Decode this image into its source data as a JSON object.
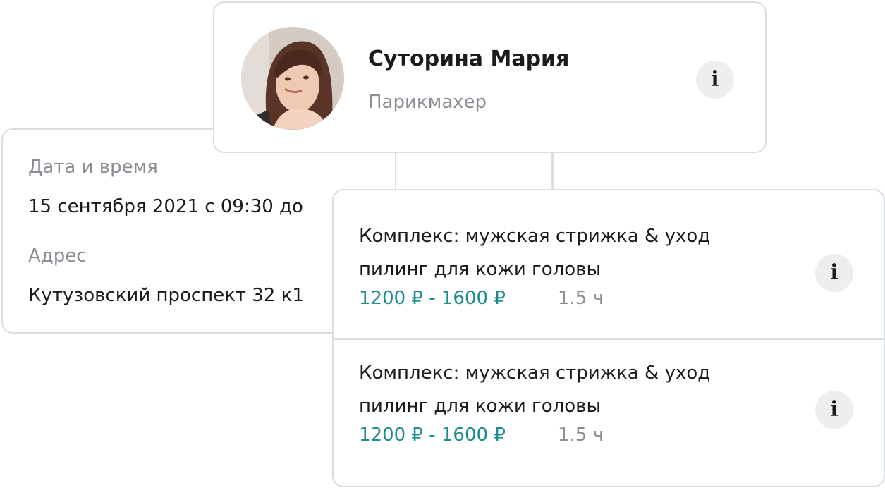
{
  "master": {
    "name": "Суторина Мария",
    "role": "Парикмахер",
    "info_icon": "i"
  },
  "details": {
    "date_label": "Дата и время",
    "date_value": "15 сентября 2021 с 09:30 до",
    "address_label": "Адрес",
    "address_value": "Кутузовский проспект 32 к1"
  },
  "services": [
    {
      "title": "Комплекс: мужская стрижка & уход пилинг для кожи головы",
      "price": "1200 ₽ - 1600 ₽",
      "duration": "1.5 ч",
      "info_icon": "i"
    },
    {
      "title": "Комплекс: мужская стрижка & уход пилинг для кожи головы",
      "price": "1200 ₽ - 1600 ₽",
      "duration": "1.5 ч",
      "info_icon": "i"
    }
  ],
  "colors": {
    "border": "#d9dee3",
    "price_accent": "#1e8c8c",
    "muted_text": "#8a8f95",
    "info_button_bg": "#eceef0"
  }
}
